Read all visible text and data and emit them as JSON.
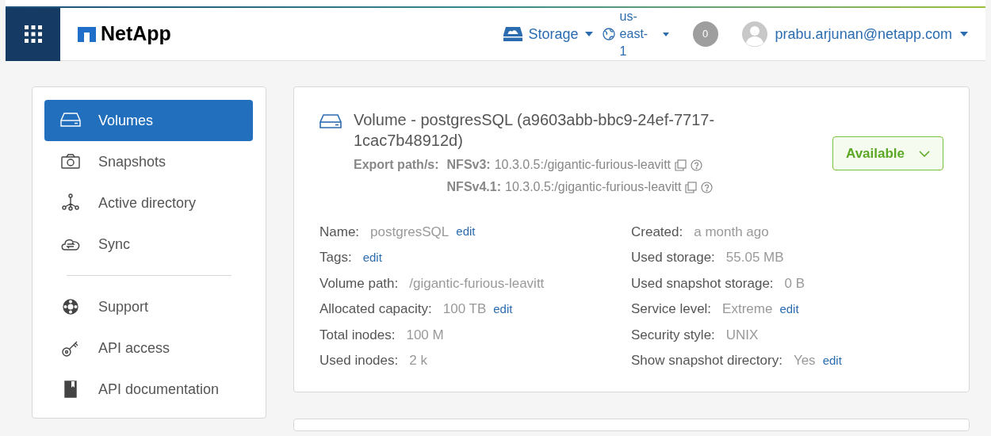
{
  "header": {
    "logo": "NetApp",
    "storage_menu": "Storage",
    "region": "us-east-1",
    "notifications": "0",
    "user": "prabu.arjunan@netapp.com"
  },
  "sidebar": {
    "groups": [
      [
        {
          "label": "Volumes",
          "selected": true
        },
        {
          "label": "Snapshots",
          "selected": false
        },
        {
          "label": "Active directory",
          "selected": false
        },
        {
          "label": "Sync",
          "selected": false
        }
      ],
      [
        {
          "label": "Support",
          "selected": false
        },
        {
          "label": "API access",
          "selected": false
        },
        {
          "label": "API documentation",
          "selected": false
        }
      ]
    ]
  },
  "volume": {
    "title": "Volume - postgresSQL (a9603abb-bbc9-24ef-7717-1cac7b48912d)",
    "status": "Available",
    "export_label": "Export path/s:",
    "exports": [
      {
        "protocol": "NFSv3:",
        "path": "10.3.0.5:/gigantic-furious-leavitt"
      },
      {
        "protocol": "NFSv4.1:",
        "path": "10.3.0.5:/gigantic-furious-leavitt"
      }
    ],
    "details_left": [
      {
        "label": "Name:",
        "value": "postgresSQL",
        "edit": "edit"
      },
      {
        "label": "Tags:",
        "edit": "edit"
      },
      {
        "label": "Volume path:",
        "value": "/gigantic-furious-leavitt"
      },
      {
        "label": "Allocated capacity:",
        "value": "100 TB",
        "edit": "edit"
      },
      {
        "label": "Total inodes:",
        "value": "100 M"
      },
      {
        "label": "Used inodes:",
        "value": "2 k"
      }
    ],
    "details_right": [
      {
        "label": "Created:",
        "value": "a month ago"
      },
      {
        "label": "Used storage:",
        "value": "55.05 MB"
      },
      {
        "label": "Used snapshot storage:",
        "value": "0 B"
      },
      {
        "label": "Service level:",
        "value": "Extreme",
        "edit": "edit"
      },
      {
        "label": "Security style:",
        "value": "UNIX"
      },
      {
        "label": "Show snapshot directory:",
        "value": "Yes",
        "edit": "edit"
      }
    ]
  }
}
